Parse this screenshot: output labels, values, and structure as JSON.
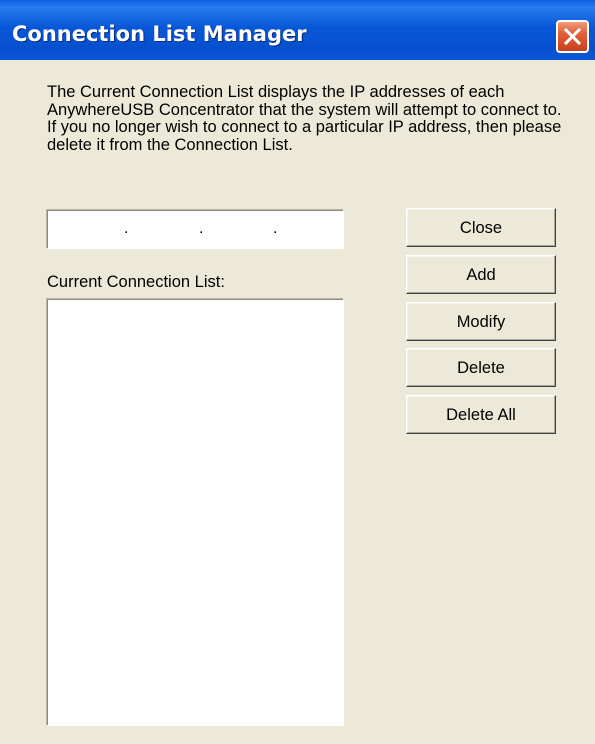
{
  "window": {
    "title": "Connection List Manager"
  },
  "description": "The Current Connection List displays the IP addresses of each AnywhereUSB Concentrator that the system will attempt to connect to. If you no longer wish to connect to a particular IP address, then please delete it from the Connection List.",
  "ip_input": {
    "dots": [
      ".",
      ".",
      "."
    ]
  },
  "list": {
    "label": "Current Connection List:",
    "items": []
  },
  "buttons": {
    "close": "Close",
    "add": "Add",
    "modify": "Modify",
    "delete": "Delete",
    "delete_all": "Delete All"
  },
  "icons": {
    "title_close": "close-icon"
  },
  "colors": {
    "titlebar": "#0857d8",
    "close_button": "#e06038",
    "dialog_background": "#ece9d8"
  }
}
